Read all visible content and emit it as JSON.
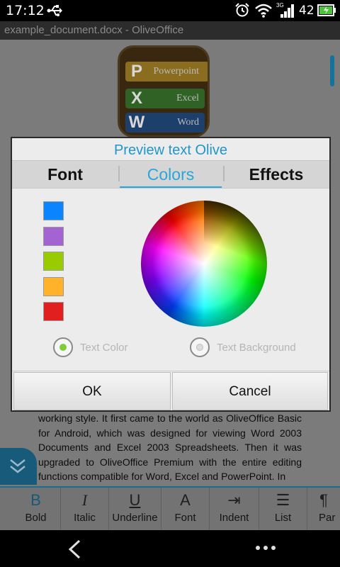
{
  "status_bar": {
    "time": "17:12",
    "signal_tag": "3G",
    "battery_level": "42",
    "icons": [
      "usb-icon",
      "alarm-icon",
      "wifi-icon",
      "signal-icon",
      "battery-icon"
    ]
  },
  "app": {
    "title": "example_document.docx - OliveOffice"
  },
  "logo": {
    "letters": [
      "P",
      "X",
      "W"
    ],
    "names": [
      "Powerpoint",
      "Excel",
      "Word"
    ]
  },
  "document": {
    "paragraph": "working style. It first came to the world as OliveOffice Basic for Android, which was designed for viewing Word 2003 Documents and Excel 2003 Spreadsheets. Then it was upgraded to OliveOffice Premium with the entire editing functions compatible for Word, Excel and PowerPoint. In"
  },
  "dialog": {
    "title": "Preview text Olive",
    "tabs": [
      {
        "label": "Font"
      },
      {
        "label": "Colors"
      },
      {
        "label": "Effects"
      }
    ],
    "selected_tab": "Colors",
    "swatches": [
      {
        "color": "#0a84ff"
      },
      {
        "color": "#a463d3"
      },
      {
        "color": "#99cc00"
      },
      {
        "color": "#ffb22a"
      },
      {
        "color": "#e11f1f"
      }
    ],
    "radio_text_color": "Text Color",
    "radio_text_background": "Text Background",
    "ok_label": "OK",
    "cancel_label": "Cancel"
  },
  "toolbar": {
    "items": [
      {
        "label": "Bold",
        "glyph": "B"
      },
      {
        "label": "Italic",
        "glyph": "I"
      },
      {
        "label": "Underline",
        "glyph": "U"
      },
      {
        "label": "Font",
        "glyph": "A"
      },
      {
        "label": "Indent",
        "glyph": "⇥"
      },
      {
        "label": "List",
        "glyph": "☰"
      },
      {
        "label": "Par",
        "glyph": "¶"
      }
    ]
  },
  "colors": {
    "accent": "#2aa6d9",
    "radio_selected": "#7fcc3a"
  }
}
